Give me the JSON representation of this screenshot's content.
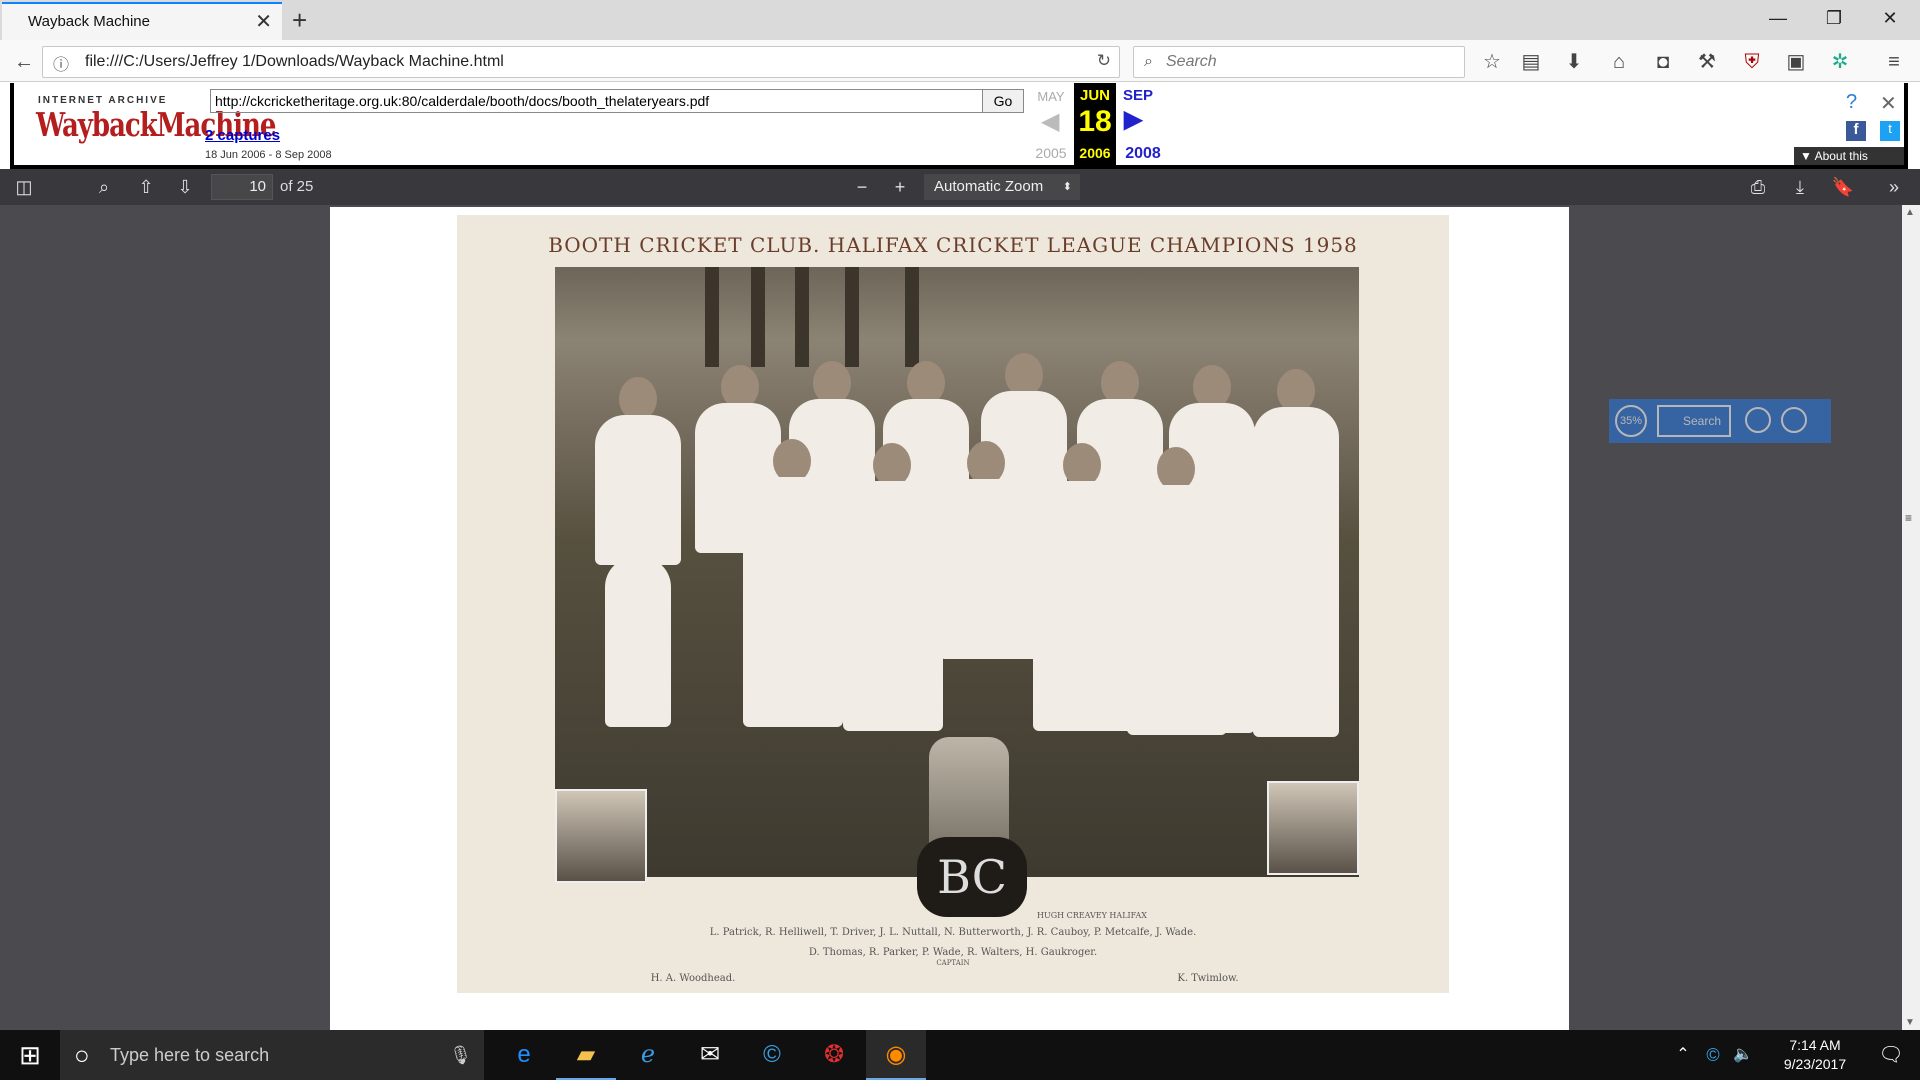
{
  "browser": {
    "tab_title": "Wayback Machine",
    "new_tab_symbol": "+",
    "url": "file:///C:/Users/Jeffrey 1/Downloads/Wayback Machine.html",
    "search_placeholder": "Search"
  },
  "wayback": {
    "logo_top": "INTERNET ARCHIVE",
    "logo_main": "WaybackMachine",
    "input_url": "http://ckcricketheritage.org.uk:80/calderdale/booth/docs/booth_thelateryears.pdf",
    "go_label": "Go",
    "captures_link": "2 captures",
    "capture_range": "18 Jun 2006 - 8 Sep 2008",
    "prev_month": "MAY",
    "current_month": "JUN",
    "next_month": "SEP",
    "current_day": "18",
    "prev_year": "2005",
    "current_year": "2006",
    "next_year": "2008",
    "about_label": "About this capture"
  },
  "pdf_toolbar": {
    "page_number": "10",
    "page_count": "of 25",
    "zoom": "Automatic Zoom"
  },
  "photo": {
    "title": "BOOTH CRICKET CLUB. HALIFAX CRICKET LEAGUE CHAMPIONS 1958",
    "caption_line1": "L. Patrick,  R. Helliwell,  T. Driver,  J. L. Nuttall,  N. Butterworth,  J. R. Cauboy,  P. Metcalfe,  J. Wade.",
    "caption_line2": "D. Thomas,  R. Parker,  P. Wade,  R. Walters,  H. Gaukroger.",
    "captain_label": "CAPTAIN",
    "inset_left_name": "H. A. Woodhead.",
    "inset_right_name": "K. Twimlow.",
    "studio_credit": "HUGH CREAVEY HALIFAX"
  },
  "float_widget": {
    "percent": "35%",
    "search": "Search"
  },
  "taskbar": {
    "search_placeholder": "Type here to search",
    "time": "7:14 AM",
    "date": "9/23/2017"
  }
}
